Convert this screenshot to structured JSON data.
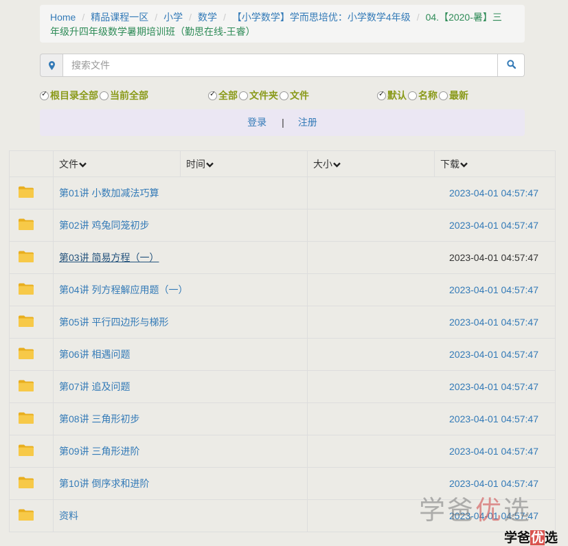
{
  "breadcrumb": {
    "items": [
      "Home",
      "精品课程一区",
      "小学",
      "数学",
      "【小学数学】学而思培优：小学数学4年级"
    ],
    "current_line1": "04.【2020-暑】三",
    "current_line2": "年级升四年级数学暑期培训班（勤思在线-王睿）"
  },
  "search": {
    "placeholder": "搜索文件",
    "value": ""
  },
  "filters": {
    "scope": [
      {
        "label": "根目录全部",
        "checked": true
      },
      {
        "label": "当前全部",
        "checked": false
      }
    ],
    "type": [
      {
        "label": "全部",
        "checked": true
      },
      {
        "label": "文件夹",
        "checked": false
      },
      {
        "label": "文件",
        "checked": false
      }
    ],
    "sort": [
      {
        "label": "默认",
        "checked": true
      },
      {
        "label": "名称",
        "checked": false
      },
      {
        "label": "最新",
        "checked": false
      }
    ]
  },
  "auth": {
    "login": "登录",
    "separator": "|",
    "register": "注册"
  },
  "table": {
    "headers": [
      "文件",
      "时间",
      "大小",
      "下载"
    ],
    "rows": [
      {
        "name": "第01讲 小数加减法巧算",
        "time": "2023-04-01 04:57:47"
      },
      {
        "name": "第02讲 鸡兔同笼初步",
        "time": "2023-04-01 04:57:47"
      },
      {
        "name": "第03讲 简易方程（一）",
        "time": "2023-04-01 04:57:47"
      },
      {
        "name": "第04讲 列方程解应用题（一）",
        "time": "2023-04-01 04:57:47"
      },
      {
        "name": "第05讲 平行四边形与梯形",
        "time": "2023-04-01 04:57:47"
      },
      {
        "name": "第06讲 相遇问题",
        "time": "2023-04-01 04:57:47"
      },
      {
        "name": "第07讲 追及问题",
        "time": "2023-04-01 04:57:47"
      },
      {
        "name": "第08讲 三角形初步",
        "time": "2023-04-01 04:57:47"
      },
      {
        "name": "第09讲 三角形进阶",
        "time": "2023-04-01 04:57:47"
      },
      {
        "name": "第10讲 倒序求和进阶",
        "time": "2023-04-01 04:57:47"
      },
      {
        "name": "资料",
        "time": "2023-04-01 04:57:47"
      }
    ],
    "active_row": 2
  },
  "watermark": {
    "part1": "学爸",
    "part2": "优",
    "part3": "选"
  },
  "logo": {
    "part1": "学爸",
    "part2": "优",
    "part3": "选"
  },
  "icons": {
    "search_left": "map-marker-icon",
    "search_right": "magnifier-icon",
    "row": "folder-icon",
    "sort": "chevron-down-icon"
  },
  "colors": {
    "link": "#337ab7",
    "filter": "#8a9a1a",
    "breadcrumb_current": "#2e8b57",
    "folder": "#f5c542"
  }
}
